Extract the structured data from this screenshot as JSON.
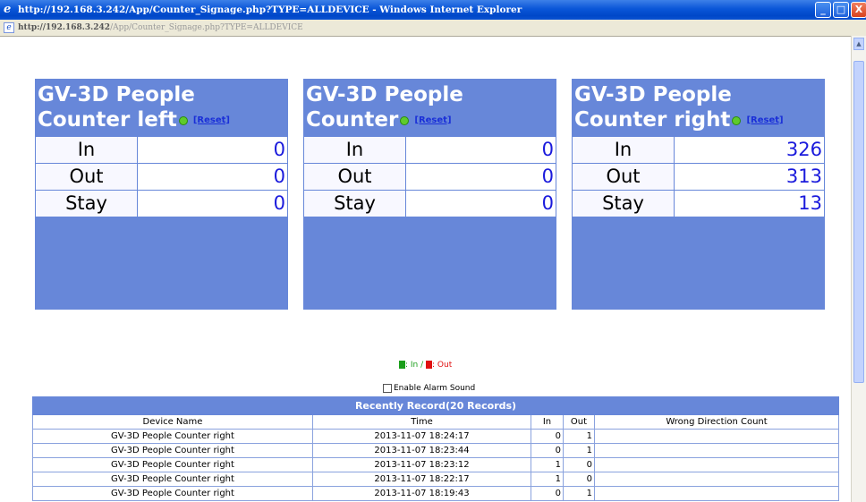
{
  "window": {
    "title": "http://192.168.3.242/App/Counter_Signage.php?TYPE=ALLDEVICE - Windows Internet Explorer",
    "minimize": "_",
    "maximize": "□",
    "close": "X"
  },
  "address": {
    "host": "http://192.168.3.242",
    "path": "/App/Counter_Signage.php?TYPE=ALLDEVICE"
  },
  "panels": [
    {
      "title": "GV-3D People Counter left",
      "reset": "[Reset]",
      "rows": [
        {
          "label": "In",
          "value": "0"
        },
        {
          "label": "Out",
          "value": "0"
        },
        {
          "label": "Stay",
          "value": "0"
        }
      ]
    },
    {
      "title": "GV-3D People Counter",
      "reset": "[Reset]",
      "rows": [
        {
          "label": "In",
          "value": "0"
        },
        {
          "label": "Out",
          "value": "0"
        },
        {
          "label": "Stay",
          "value": "0"
        }
      ]
    },
    {
      "title": "GV-3D People Counter right",
      "reset": "[Reset]",
      "rows": [
        {
          "label": "In",
          "value": "326"
        },
        {
          "label": "Out",
          "value": "313"
        },
        {
          "label": "Stay",
          "value": "13"
        }
      ]
    }
  ],
  "legend": {
    "in_label": ": In /",
    "out_label": ": Out",
    "in_color": "#1a9e1a",
    "out_color": "#e01010"
  },
  "alarm": {
    "label": "Enable Alarm Sound",
    "checked": false
  },
  "records": {
    "caption": "Recently Record(20 Records)",
    "headers": [
      "Device Name",
      "Time",
      "In",
      "Out",
      "Wrong Direction Count"
    ],
    "rows": [
      [
        "GV-3D People Counter right",
        "2013-11-07 18:24:17",
        "0",
        "1",
        ""
      ],
      [
        "GV-3D People Counter right",
        "2013-11-07 18:23:44",
        "0",
        "1",
        ""
      ],
      [
        "GV-3D People Counter right",
        "2013-11-07 18:23:12",
        "1",
        "0",
        ""
      ],
      [
        "GV-3D People Counter right",
        "2013-11-07 18:22:17",
        "1",
        "0",
        ""
      ],
      [
        "GV-3D People Counter right",
        "2013-11-07 18:19:43",
        "0",
        "1",
        ""
      ]
    ]
  }
}
